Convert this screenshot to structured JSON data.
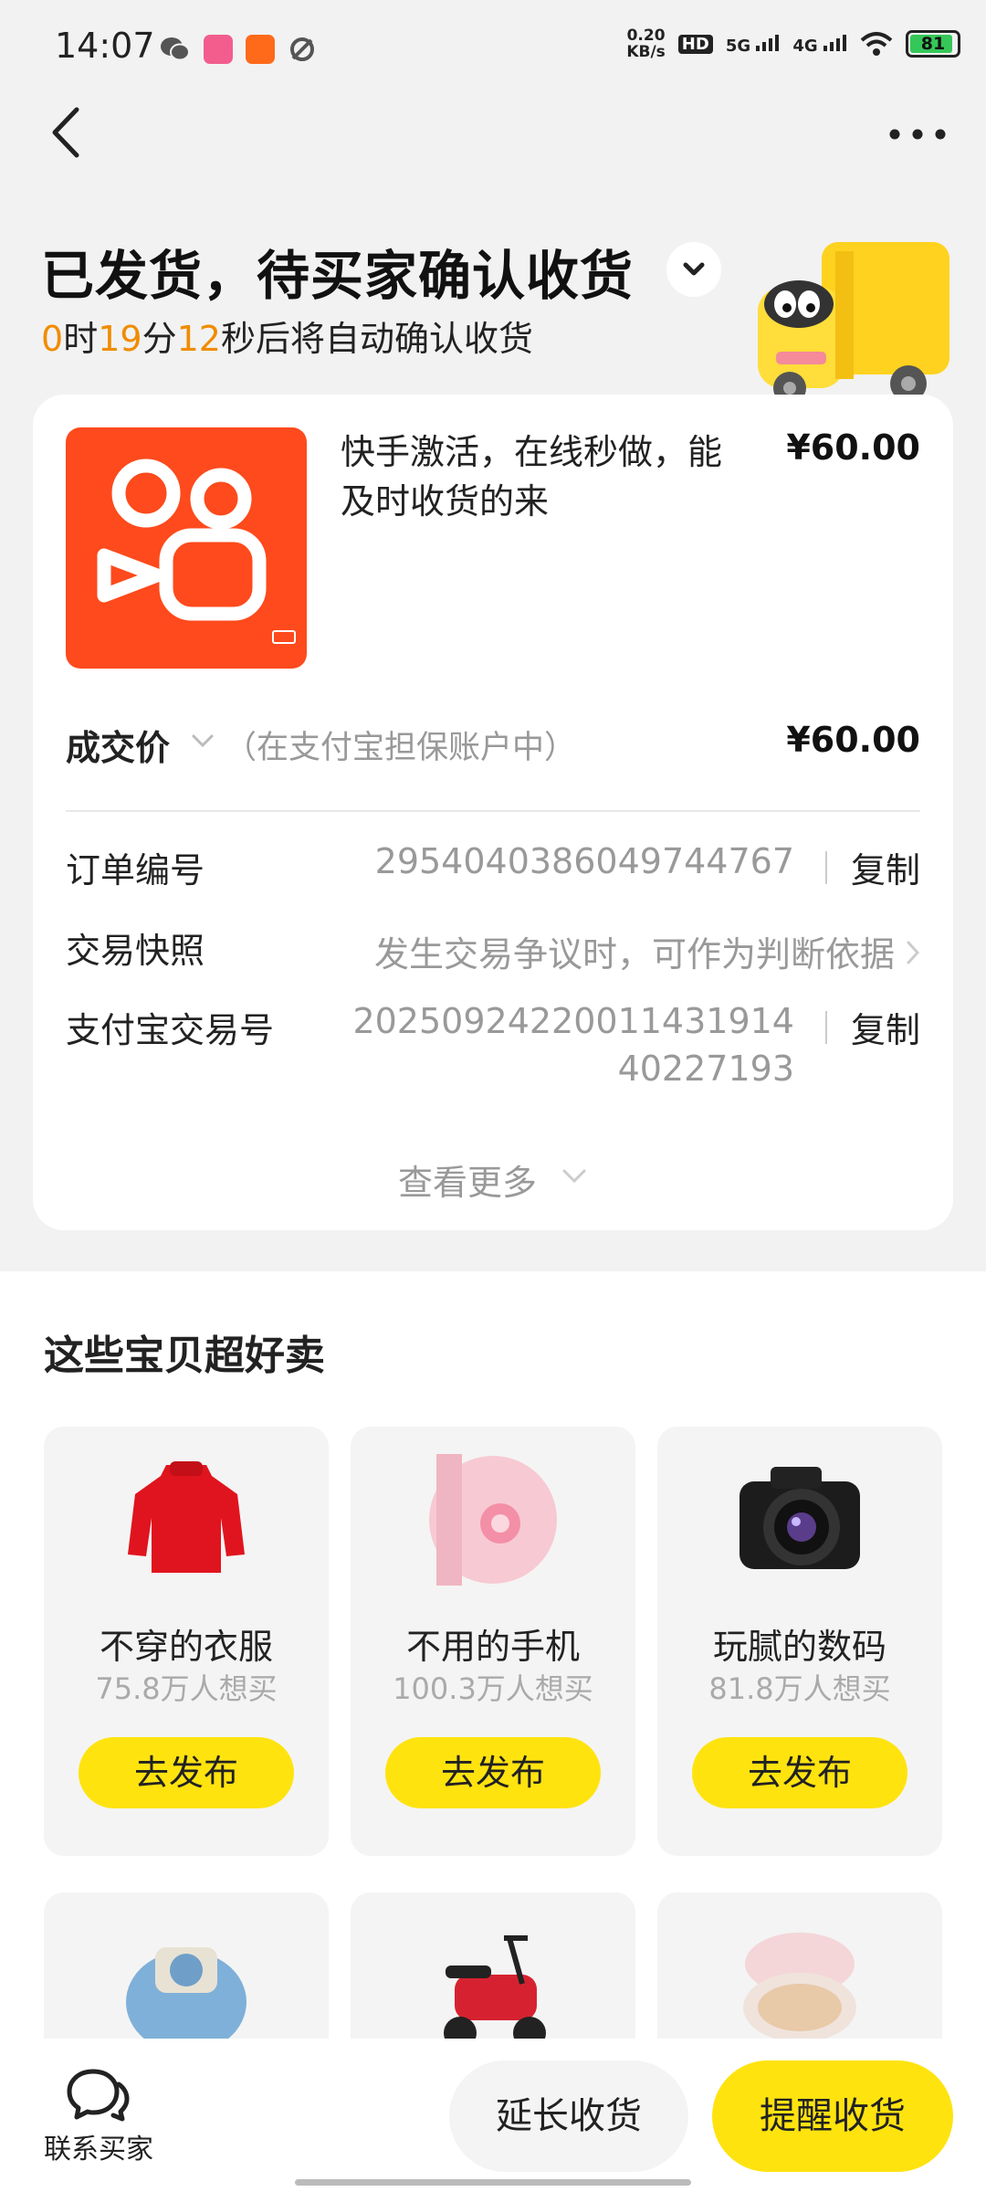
{
  "status_bar": {
    "time": "14:07",
    "net_speed_value": "0.20",
    "net_speed_unit": "KB/s",
    "hd_tag": "HD",
    "sim1_tag": "5G",
    "sim2_tag": "4G",
    "battery": "81"
  },
  "header": {
    "status_title": "已发货，待买家确认收货",
    "countdown": {
      "hours": "0",
      "hours_unit": "时",
      "minutes": "19",
      "minutes_unit": "分",
      "seconds": "12",
      "suffix": "秒后将自动确认收货"
    }
  },
  "order": {
    "product_title": "快手激活，在线秒做，能及时收货的来",
    "product_price": "¥60.00",
    "deal_label": "成交价",
    "deal_note": "（在支付宝担保账户中）",
    "deal_price": "¥60.00",
    "order_no_label": "订单编号",
    "order_no": "2954040386049744767",
    "snapshot_label": "交易快照",
    "snapshot_value": "发生交易争议时，可作为判断依据",
    "alipay_label": "支付宝交易号",
    "alipay_no_line1": "20250924220011431914",
    "alipay_no_line2": "40227193",
    "copy_label": "复制",
    "view_more": "查看更多"
  },
  "recommend": {
    "title": "这些宝贝超好卖",
    "items": [
      {
        "name": "不穿的衣服",
        "sub": "75.8万人想买",
        "button": "去发布"
      },
      {
        "name": "不用的手机",
        "sub": "100.3万人想买",
        "button": "去发布"
      },
      {
        "name": "玩腻的数码",
        "sub": "81.8万人想买",
        "button": "去发布"
      }
    ]
  },
  "bottom": {
    "contact_label": "联系买家",
    "extend_label": "延长收货",
    "remind_label": "提醒收货"
  },
  "colors": {
    "accent_yellow": "#ffe30f",
    "countdown_orange": "#f08c00",
    "kuaishou_orange": "#fe4a1c"
  }
}
